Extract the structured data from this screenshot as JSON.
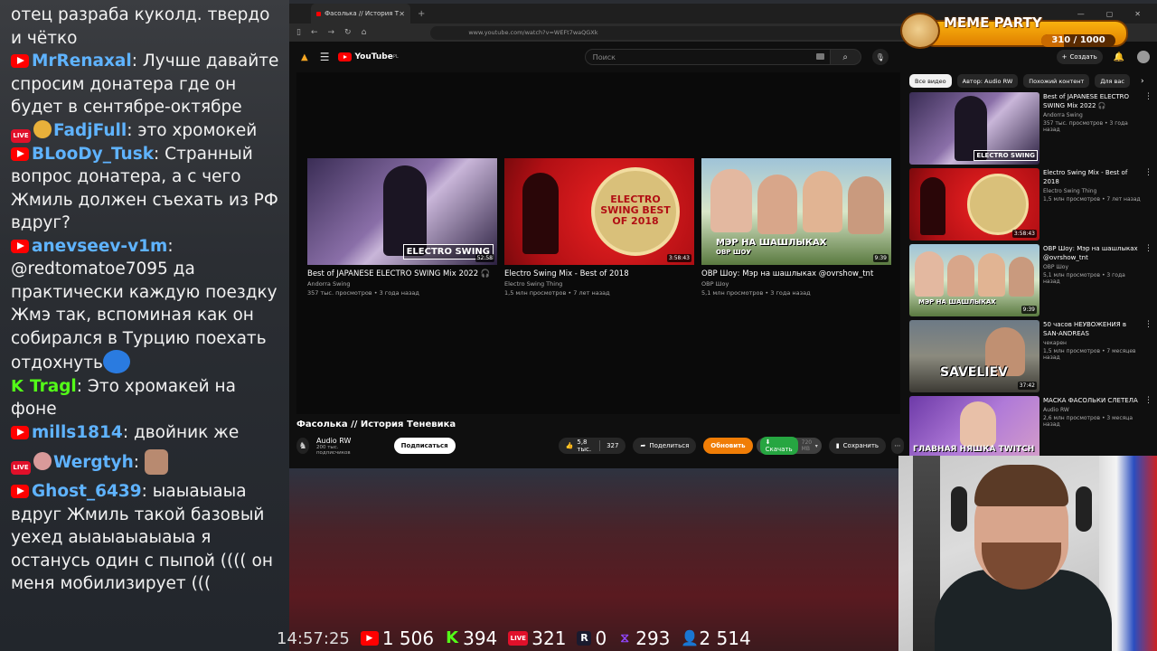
{
  "chat": {
    "messages": [
      {
        "platform": "none",
        "user": "",
        "user_color": "#ffffff",
        "text": "отец разраба куколд. твердо и чётко"
      },
      {
        "platform": "youtube",
        "user": "MrRenaxal",
        "user_color": "#5fb3ff",
        "text": "Лучше давайте спросим донатера где он будет в сентябре-октябре"
      },
      {
        "platform": "live",
        "user": "FadjFull",
        "user_color": "#5fb3ff",
        "text": "это хромокей"
      },
      {
        "platform": "youtube",
        "user": "BLooDy_Tusk",
        "user_color": "#5fb3ff",
        "text": "Странный вопрос донатера, а с чего Жмиль должен съехать из РФ вдруг?"
      },
      {
        "platform": "youtube",
        "user": "anevseev-v1m",
        "user_color": "#5fb3ff",
        "text": "@redtomatoe7095 да практически каждую поездку Жмэ так, вспоминая как он собирался в Турцию поехать отдохнуть"
      },
      {
        "platform": "kick",
        "user": "Tragl",
        "user_color": "#53fc18",
        "text": "Это хромакей на фоне"
      },
      {
        "platform": "youtube",
        "user": "mills1814",
        "user_color": "#5fb3ff",
        "text": "двойник же"
      },
      {
        "platform": "live",
        "user": "Wergtyh",
        "user_color": "#5fb3ff",
        "text": ""
      },
      {
        "platform": "youtube",
        "user": "Ghost_6439",
        "user_color": "#5fb3ff",
        "text": "ыаыаыаыа вдруг Жмиль такой базовый уехед аыаыаыаыаыа я останусь один с пыпой (((( он меня мобилизирует ((("
      }
    ]
  },
  "browser": {
    "tab_title": "Фасолька // История Теневика",
    "url": "www.youtube.com/watch?v=WEFt7waQGXk",
    "logo_text": "YouTube",
    "logo_country": "PL",
    "search_placeholder": "Поиск",
    "create_label": "Создать"
  },
  "endcards": [
    {
      "title": "Best of JAPANESE ELECTRO SWING Mix 2022 🎧",
      "channel": "Andorra Swing",
      "views": "357 тыс. просмотров • 3 года назад",
      "duration": "52:58",
      "overlay": "ELECTRO SWING"
    },
    {
      "title": "Electro Swing Mix - Best of 2018",
      "channel": "Electro Swing Thing",
      "views": "1,5 млн просмотров • 7 лет назад",
      "duration": "3:58:43",
      "overlay": "ELECTRO SWING BEST OF 2018"
    },
    {
      "title": "ОВР Шоу: Мэр на шашлыках @ovrshow_tnt",
      "channel": "ОВР Шоу",
      "views": "5,1 млн просмотров • 3 года назад",
      "duration": "9:39",
      "overlay": "МЭР НА ШАШЛЫКАХ",
      "overlay_sub": "ОВР ШОУ"
    }
  ],
  "video": {
    "title": "Фасолька // История Теневика",
    "channel": "Audio RW",
    "subscribers": "200 тыс. подписчиков",
    "subscribe_label": "Подписаться",
    "likes": "5,8 тыс.",
    "dislikes": "327",
    "share_label": "Поделиться",
    "update_label": "Обновить",
    "download_label": "Скачать",
    "quality_label": "720 MB",
    "save_label": "Сохранить"
  },
  "chips": [
    "Все видео",
    "Автор: Audio RW",
    "Похожий контент",
    "Для вас"
  ],
  "recommendations": [
    {
      "title": "Best of JAPANESE ELECTRO SWING Mix 2022 🎧",
      "channel": "Andorra Swing",
      "views": "357 тыс. просмотров • 3 года назад",
      "duration": "52:58"
    },
    {
      "title": "Electro Swing Mix - Best of 2018",
      "channel": "Electro Swing Thing",
      "views": "1,5 млн просмотров • 7 лет назад",
      "duration": "3:58:43"
    },
    {
      "title": "ОВР Шоу: Мэр на шашлыках @ovrshow_tnt",
      "channel": "ОВР Шоу",
      "views": "5,1 млн просмотров • 3 года назад",
      "duration": "9:39"
    },
    {
      "title": "50 часов НЕУВОЖЕНИЯ в SAN-ANDREAS",
      "channel": "чекарен",
      "views": "1,5 млн просмотров • 7 месяцев назад",
      "duration": "37:42",
      "overlay": "SAVELIEV"
    },
    {
      "title": "МАСКА ФАСОЛЬКИ СЛЕТЕЛА",
      "channel": "Audio RW",
      "views": "2,6 млн просмотров • 3 месяца назад",
      "duration": "",
      "overlay": "ГЛАВНАЯ НЯШКА TWITCH"
    }
  ],
  "stream_stats": {
    "time": "14:57:25",
    "youtube": "1 506",
    "kick": "394",
    "live": "321",
    "rutube": "0",
    "twitch": "293",
    "total": "2 514"
  },
  "meme_party": {
    "title": "MEME PARTY",
    "progress_text": "310 / 1000",
    "progress": 0.31
  },
  "colors": {
    "youtube_red": "#ff0000",
    "kick_green": "#53fc18",
    "twitch_purple": "#9146ff",
    "update_orange": "#f07d06",
    "download_green": "#26a641",
    "username_blue": "#5fb3ff"
  }
}
